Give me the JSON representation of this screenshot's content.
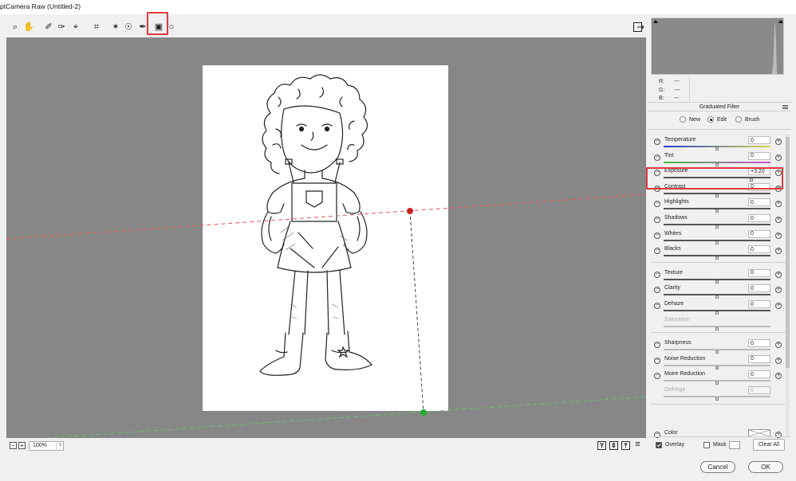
{
  "window": {
    "title": "ptCamera Raw (Untitled-2)"
  },
  "toolbar": {
    "tools": [
      {
        "name": "zoom-icon",
        "glyph": "⌕"
      },
      {
        "name": "hand-icon",
        "glyph": "✋"
      },
      {
        "name": "white-balance-icon",
        "glyph": "✐"
      },
      {
        "name": "color-sampler-icon",
        "glyph": "✑"
      },
      {
        "name": "targeted-adjustment-icon",
        "glyph": "⌖"
      },
      {
        "name": "crop-icon",
        "glyph": "⌗"
      },
      {
        "name": "spot-removal-icon",
        "glyph": "✶"
      },
      {
        "name": "red-eye-icon",
        "glyph": "☉"
      },
      {
        "name": "adjustment-brush-icon",
        "glyph": "✒"
      },
      {
        "name": "graduated-filter-icon",
        "glyph": "▣"
      },
      {
        "name": "radial-filter-icon",
        "glyph": "○"
      }
    ]
  },
  "status": {
    "zoom": "100%",
    "minus": "−",
    "plus": "+",
    "zoom_arrow": "∨",
    "view_y": "Y",
    "view_swap": "⇕",
    "view_copy": "⤒",
    "view_settings": "≡"
  },
  "rgb": {
    "r_label": "R:",
    "g_label": "G:",
    "b_label": "B:",
    "r": "---",
    "g": "---",
    "b": "---"
  },
  "panel": {
    "title": "Graduated Filter",
    "modes": [
      {
        "label": "New",
        "selected": false
      },
      {
        "label": "Edit",
        "selected": true
      },
      {
        "label": "Brush",
        "selected": false
      }
    ],
    "sliders": [
      {
        "label": "Temperature",
        "value": "0",
        "level": 0.5,
        "track": "temp",
        "enabled": true
      },
      {
        "label": "Tint",
        "value": "0",
        "level": 0.5,
        "track": "tint",
        "enabled": true
      },
      {
        "label": "Exposure",
        "value": "+3.20",
        "level": 0.82,
        "track": "plain",
        "enabled": true,
        "highlighted": true
      },
      {
        "label": "Contrast",
        "value": "0",
        "level": 0.5,
        "track": "plain",
        "enabled": true
      },
      {
        "label": "Highlights",
        "value": "0",
        "level": 0.5,
        "track": "plain",
        "enabled": true
      },
      {
        "label": "Shadows",
        "value": "0",
        "level": 0.5,
        "track": "plain",
        "enabled": true
      },
      {
        "label": "Whites",
        "value": "0",
        "level": 0.5,
        "track": "plain",
        "enabled": true
      },
      {
        "label": "Blacks",
        "value": "0",
        "level": 0.5,
        "track": "plain",
        "enabled": true
      },
      {
        "label": "Texture",
        "value": "0",
        "level": 0.5,
        "track": "plain",
        "enabled": true,
        "gap": true
      },
      {
        "label": "Clarity",
        "value": "0",
        "level": 0.5,
        "track": "plain",
        "enabled": true
      },
      {
        "label": "Dehaze",
        "value": "0",
        "level": 0.5,
        "track": "plain",
        "enabled": true
      },
      {
        "label": "Saturation",
        "value": "",
        "level": 0.5,
        "track": "plain",
        "enabled": false
      },
      {
        "label": "Sharpness",
        "value": "0",
        "level": 0.5,
        "track": "light",
        "enabled": true,
        "gap": true
      },
      {
        "label": "Noise Reduction",
        "value": "0",
        "level": 0.5,
        "track": "light",
        "enabled": true
      },
      {
        "label": "Moire Reduction",
        "value": "0",
        "level": 0.5,
        "track": "light",
        "enabled": true
      },
      {
        "label": "Defringe",
        "value": "0",
        "level": 0.5,
        "track": "light",
        "enabled": false
      }
    ],
    "color": {
      "label": "Color"
    },
    "overlay": {
      "label": "Overlay",
      "checked": true
    },
    "mask": {
      "label": "Mask",
      "checked": false
    },
    "clear_all": "Clear All"
  },
  "footer": {
    "cancel": "Cancel",
    "ok": "OK"
  },
  "colors": {
    "canvas": "#878787",
    "highlight": "#e0393e",
    "start_pin": "#cc2222",
    "end_pin": "#22aa33"
  }
}
